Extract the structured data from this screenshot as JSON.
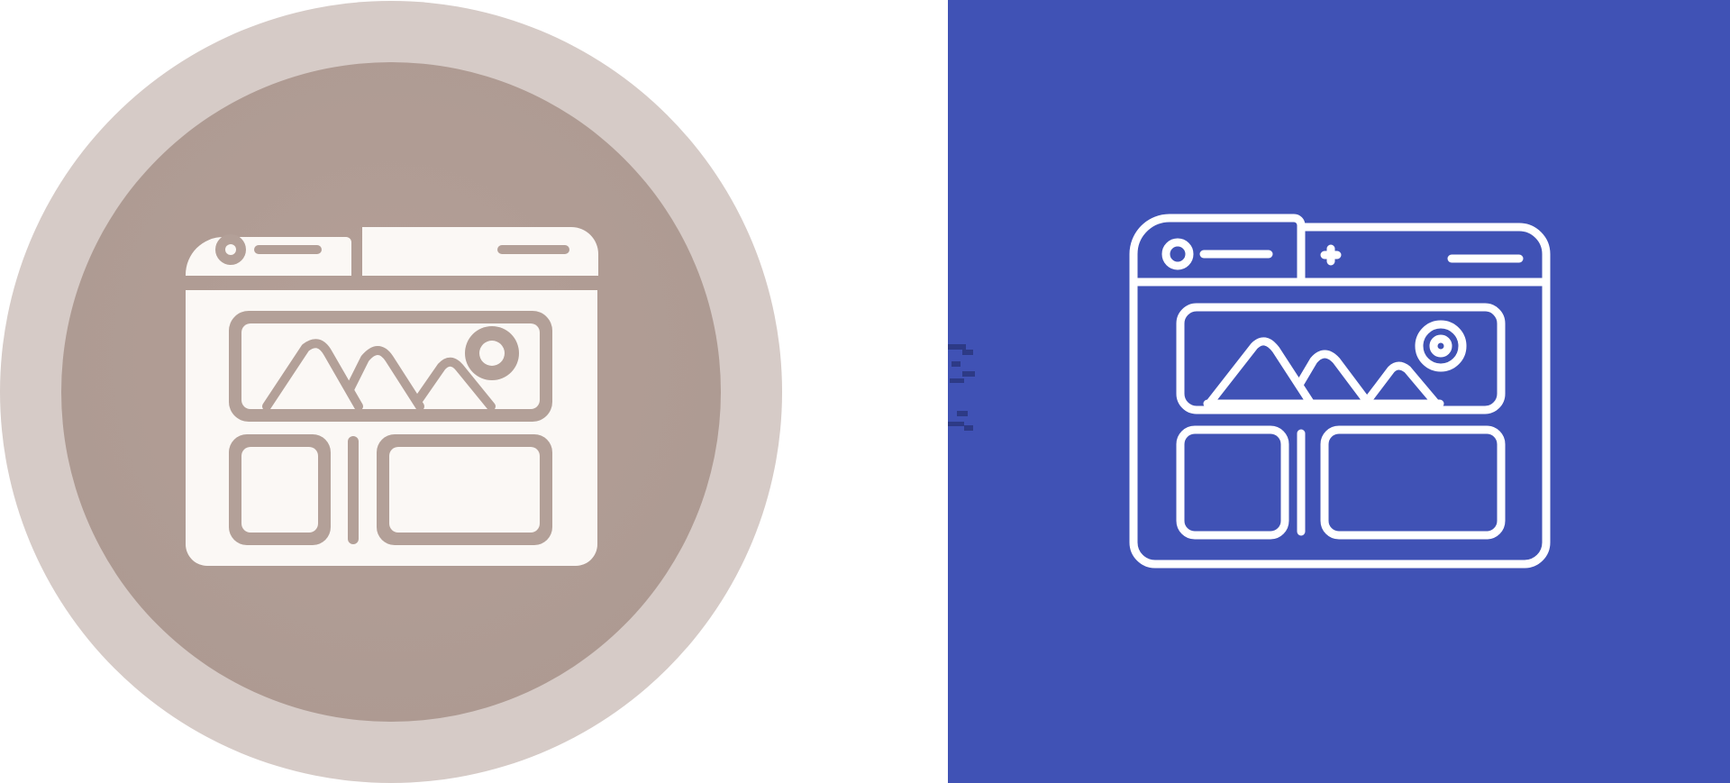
{
  "canvas": {
    "background": "#ffffff"
  },
  "icons": [
    {
      "name": "browser-image-layout-icon",
      "style": "glyph",
      "backdrop": "circle",
      "colors": {
        "outer_ring": "#d6cbc7",
        "inner_disc": "#b3a098",
        "glyph": "#fbf8f5"
      }
    },
    {
      "name": "browser-image-layout-icon",
      "style": "line",
      "backdrop": "square",
      "colors": {
        "background": "#4052b5",
        "stroke": "#ffffff"
      }
    }
  ]
}
